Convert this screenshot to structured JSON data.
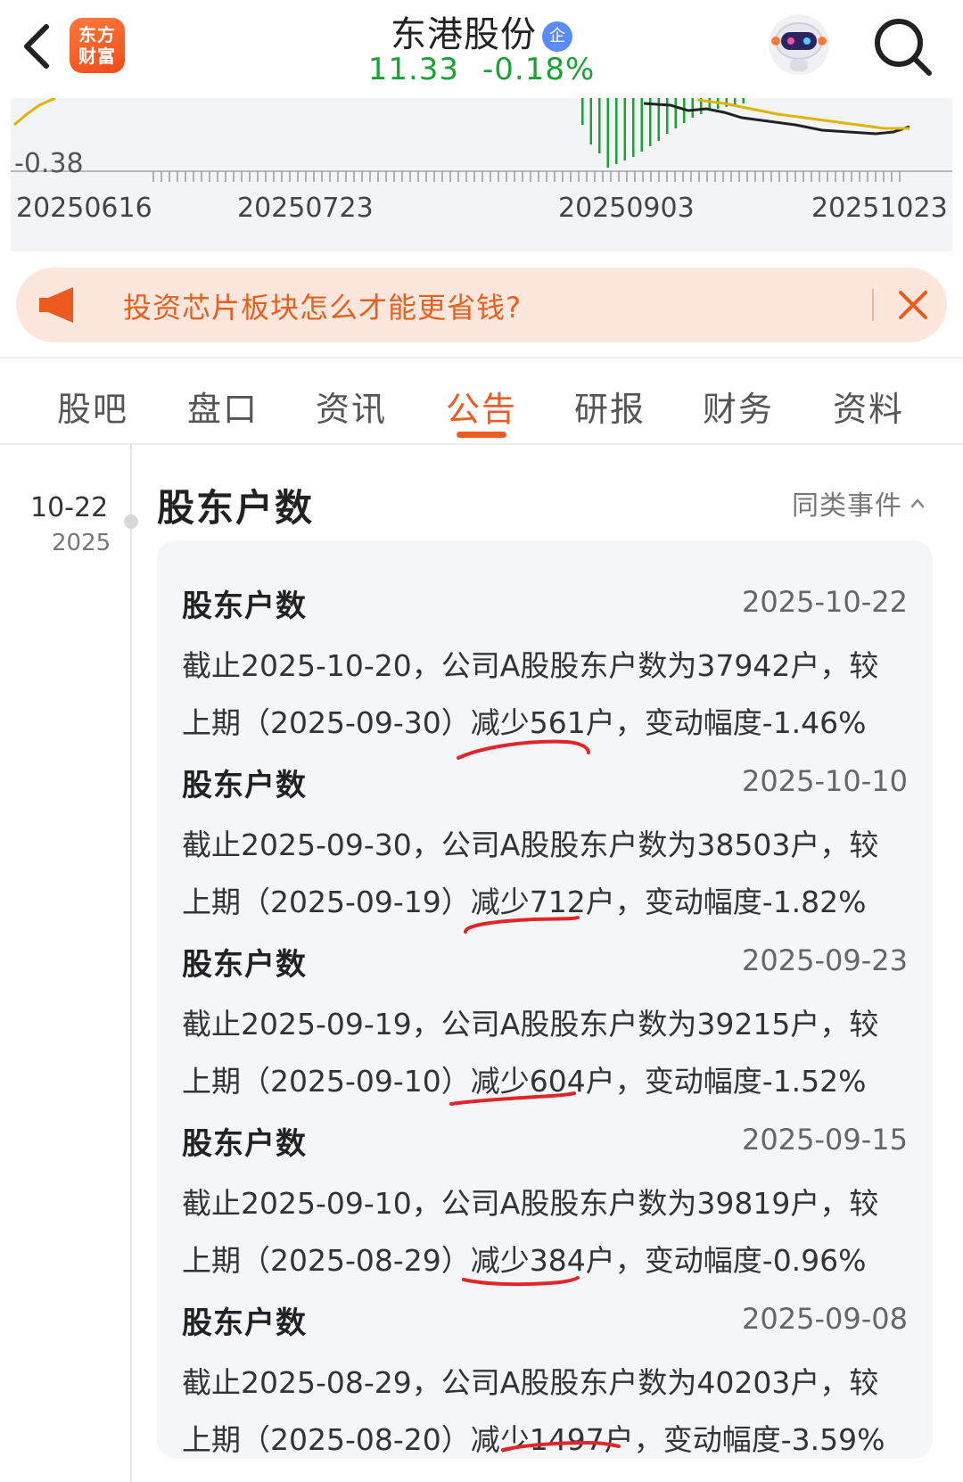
{
  "header": {
    "app_logo_text": "东方财富",
    "stock_name": "东港股份",
    "badge": "企",
    "price": "11.33",
    "change": "-0.18%"
  },
  "chart_strip": {
    "y_label": "-0.38",
    "x_ticks": [
      "20250616",
      "20250723",
      "20250903",
      "20251023"
    ],
    "colors": {
      "bar": "#1aa335",
      "line_black": "#222222",
      "line_yellow": "#e0b400"
    }
  },
  "promo": {
    "text": "投资芯片板块怎么才能更省钱?"
  },
  "tabs": [
    {
      "label": "股吧"
    },
    {
      "label": "盘口"
    },
    {
      "label": "资讯"
    },
    {
      "label": "公告",
      "active": true
    },
    {
      "label": "研报"
    },
    {
      "label": "财务"
    },
    {
      "label": "资料"
    }
  ],
  "timeline": {
    "date": "10-22",
    "year": "2025"
  },
  "section": {
    "title": "股东户数",
    "similar_label": "同类事件"
  },
  "entries": [
    {
      "title": "股东户数",
      "date": "2025-10-22",
      "line1": "截止2025-10-20，公司A股股东户数为37942户，较",
      "line2_pre": "上期（2025-09-30）",
      "line2_hl": "减少561户",
      "line2_post": "，变动幅度-1.46%"
    },
    {
      "title": "股东户数",
      "date": "2025-10-10",
      "line1": "截止2025-09-30，公司A股股东户数为38503户，较",
      "line2_pre": "上期（2025-09-19）",
      "line2_hl": "减少712户",
      "line2_post": "，变动幅度-1.82%"
    },
    {
      "title": "股东户数",
      "date": "2025-09-23",
      "line1": "截止2025-09-19，公司A股股东户数为39215户，较",
      "line2_pre": "上期（2025-09-10）",
      "line2_hl": "减少604户",
      "line2_post": "，变动幅度-1.52%"
    },
    {
      "title": "股东户数",
      "date": "2025-09-15",
      "line1": "截止2025-09-10，公司A股股东户数为39819户，较",
      "line2_pre": "上期（2025-08-29）",
      "line2_hl": "减少384户",
      "line2_post": "，变动幅度-0.96%"
    },
    {
      "title": "股东户数",
      "date": "2025-09-08",
      "line1": "截止2025-08-29，公司A股股东户数为40203户，较",
      "line2_pre": "上期（2025-08-20）",
      "line2_hl": "减少1497户",
      "line2_post": "，变动幅度-3.59%"
    }
  ],
  "annotation_color": "#e0262a"
}
